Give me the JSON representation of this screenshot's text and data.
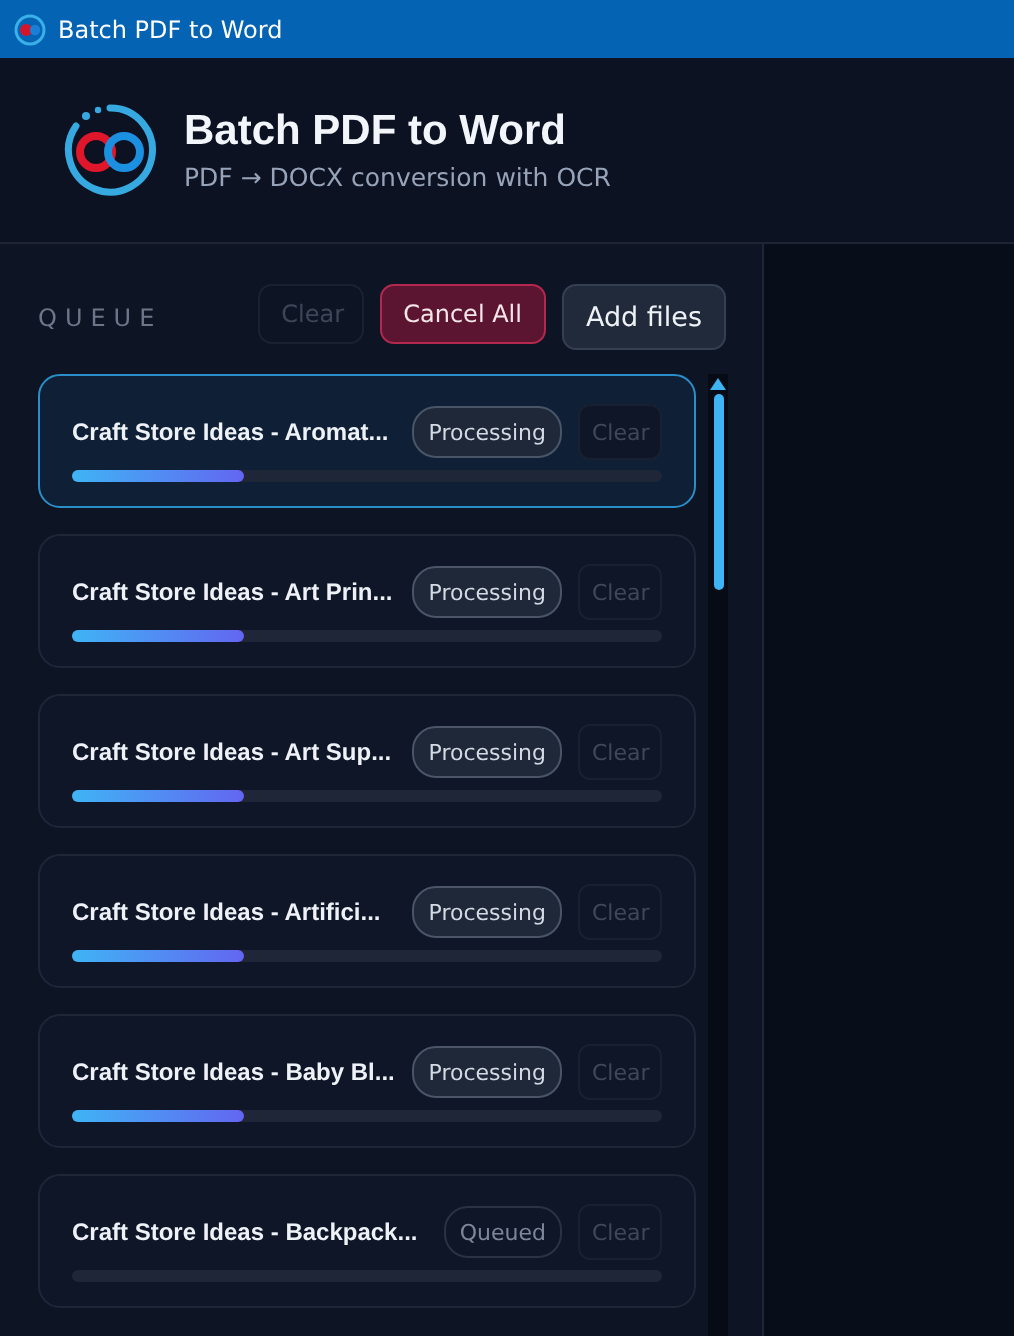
{
  "window": {
    "title": "Batch PDF to Word"
  },
  "header": {
    "title": "Batch PDF to Word",
    "subtitle": "PDF → DOCX conversion with OCR"
  },
  "queue": {
    "label": "QUEUE",
    "buttons": [
      {
        "label": "Clear",
        "kind": "ghost",
        "disabled": true
      },
      {
        "label": "Cancel All",
        "kind": "danger",
        "disabled": false
      },
      {
        "label": "Add files",
        "kind": "primary",
        "disabled": false
      }
    ],
    "items": [
      {
        "name": "Craft Store Ideas - Aromat...",
        "status": "Processing",
        "kind": "processing",
        "level": 0.29,
        "selected": true,
        "action": "Clear"
      },
      {
        "name": "Craft Store Ideas - Art Prin...",
        "status": "Processing",
        "kind": "processing",
        "level": 0.29,
        "selected": false,
        "action": "Clear"
      },
      {
        "name": "Craft Store Ideas - Art Sup...",
        "status": "Processing",
        "kind": "processing",
        "level": 0.29,
        "selected": false,
        "action": "Clear"
      },
      {
        "name": "Craft Store Ideas - Artifici...",
        "status": "Processing",
        "kind": "processing",
        "level": 0.29,
        "selected": false,
        "action": "Clear"
      },
      {
        "name": "Craft Store Ideas - Baby Bl...",
        "status": "Processing",
        "kind": "processing",
        "level": 0.29,
        "selected": false,
        "action": "Clear"
      },
      {
        "name": "Craft Store Ideas - Backpack...",
        "status": "Queued",
        "kind": "queued",
        "selected": false,
        "action": "Clear"
      }
    ]
  }
}
